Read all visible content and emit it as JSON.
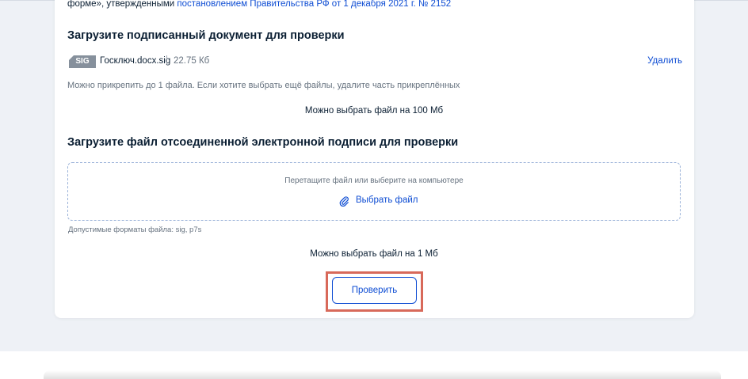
{
  "intro": {
    "prefix": "форме», утвержденными ",
    "link": "постановлением Правительства РФ от 1 декабря 2021 г. № 2152"
  },
  "signed_doc": {
    "heading": "Загрузите подписанный документ для проверки",
    "file": {
      "badge": "SIG",
      "name": "Госключ.docx.sig",
      "separator": "|",
      "size": "22.75 Кб",
      "delete_label": "Удалить"
    },
    "hint": "Можно прикрепить до 1 файла. Если хотите выбрать ещё файлы, удалите часть прикреплённых",
    "limit": "Можно выбрать файл на 100 Мб"
  },
  "detached_sig": {
    "heading": "Загрузите файл отсоединенной электронной подписи для проверки",
    "drop_text": "Перетащите файл или выберите на компьютере",
    "choose_label": "Выбрать файл",
    "choose_icon": "paperclip-icon",
    "formats": "Допустимые форматы файла: sig, p7s",
    "limit": "Можно выбрать файл на 1 Мб"
  },
  "actions": {
    "check_label": "Проверить",
    "highlight_color": "#d8695a"
  },
  "colors": {
    "accent": "#0d4cd3",
    "text": "#0b1f33",
    "muted": "#66727f",
    "page_bg": "#eef1f6"
  }
}
